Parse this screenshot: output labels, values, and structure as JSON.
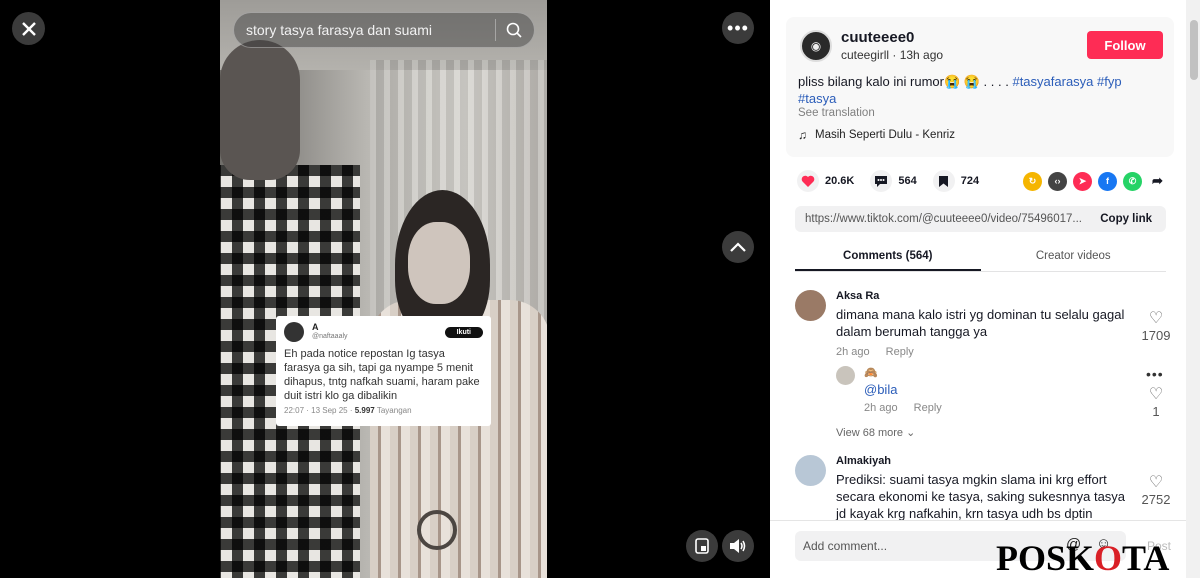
{
  "video": {
    "search_text": "story tasya farasya dan suami",
    "tweet": {
      "name": "A",
      "handle": "@naftaaaly",
      "follow_label": "Ikuti",
      "body": "Eh pada notice repostan Ig tasya farasya ga sih, tapi ga nyampe 5 menit dihapus, tntg nafkah suami, haram pake duit istri klo ga dibalikin",
      "time": "22:07 · 13 Sep 25 ·",
      "views": "5.997",
      "views_label": "Tayangan"
    }
  },
  "post": {
    "username": "cuuteeee0",
    "display_sub": "cuteegirll · 13h ago",
    "follow_label": "Follow",
    "caption_text": "pliss bilang kalo ini rumor😭 😭 . . . .",
    "hashtags": [
      "#tasyafarasya",
      "#fyp",
      "#tasya"
    ],
    "see_translation": "See translation",
    "music": "Masih Seperti Dulu - Kenriz",
    "likes": "20.6K",
    "comments_count": "564",
    "saves": "724",
    "link_url": "https://www.tiktok.com/@cuuteeee0/video/75496017...",
    "copy_link_label": "Copy link"
  },
  "tabs": {
    "comments": "Comments (564)",
    "creator_videos": "Creator videos"
  },
  "comments": [
    {
      "user": "Aksa Ra",
      "text": "dimana mana kalo istri yg dominan tu selalu gagal dalam berumah tangga ya",
      "time": "2h ago",
      "reply": "Reply",
      "likes": "1709"
    },
    {
      "user": "🙈",
      "text": "@bila",
      "time": "2h ago",
      "reply": "Reply",
      "likes": "1"
    },
    {
      "user": "Almakiyah",
      "text": "Prediksi: suami tasya mgkin slama ini krg effort secara ekonomi ke tasya, saking sukesnnya tasya jd kayak krg nafkahin, krn tasya udh bs dptin",
      "likes": "2752"
    }
  ],
  "view_more": "View 68 more",
  "add_comment": {
    "placeholder": "Add comment...",
    "post_label": "Post"
  },
  "watermark": {
    "part1": "POSK",
    "part2": "O",
    "part3": "TA"
  },
  "colors": {
    "follow": "#fe2c55",
    "hashtag": "#2b5db9",
    "like_heart": "#fe2c55"
  }
}
